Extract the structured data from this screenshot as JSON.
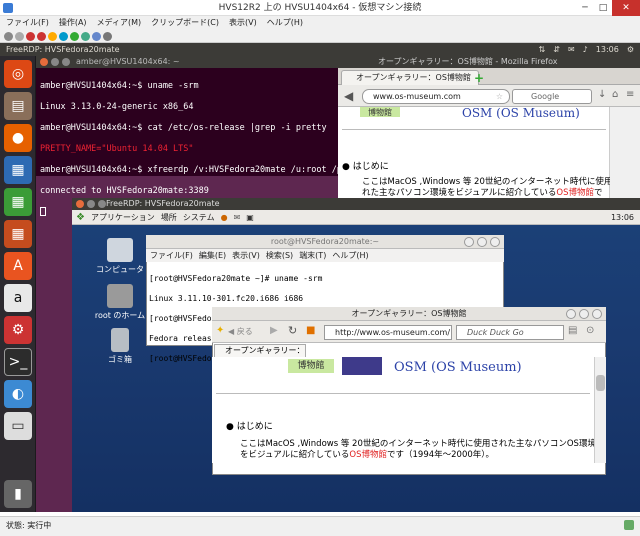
{
  "hyperv": {
    "title": "HVS12R2 上の HVSU1404x64 - 仮想マシン接続",
    "menu": [
      "ファイル(F)",
      "操作(A)",
      "メディア(M)",
      "クリップボード(C)",
      "表示(V)",
      "ヘルプ(H)"
    ],
    "status": "状態: 実行中"
  },
  "ubuntu": {
    "panel_title": "FreeRDP: HVSFedora20mate",
    "clock": "13:06",
    "terminal": {
      "title": "amber@HVSU1404x64: ~",
      "lines": [
        "amber@HVSU1404x64:~$ uname -srm",
        "Linux 3.13.0-24-generic x86_64",
        "amber@HVSU1404x64:~$ cat /etc/os-release |grep -i pretty",
        "PRETTY_NAME=\"Ubuntu 14.04 LTS\"",
        "amber@HVSU1404x64:~$ xfreerdp /v:HVSFedora20mate /u:root /p:",
        "connected to HVSFedora20mate:3389"
      ]
    },
    "firefox": {
      "title": "オープンギャラリー：OS博物館 - Mozilla Firefox",
      "tab": "オープンギャラリー：OS博物館",
      "url": "www.os-museum.com",
      "search": "Google",
      "site_title": "OSM (OS Museum)",
      "logo": "博物館",
      "bullet": "はじめに",
      "para_a": "ここはMacOS ,Windows 等 20世紀のインターネット時代に使用さ",
      "para_b": "れた主なパソコン環境をビジュアルに紹介している",
      "link": "OS博物館",
      "para_c": "で"
    }
  },
  "freerdp": {
    "title": "FreeRDP: HVSFedora20mate",
    "panel_menu": [
      "アプリケーション",
      "場所",
      "システム"
    ],
    "clock": "13:06",
    "desktop_icons": [
      "コンピュータ",
      "root のホーム",
      "ゴミ箱"
    ],
    "terminal": {
      "title": "root@HVSFedora20mate:~",
      "menu": [
        "ファイル(F)",
        "編集(E)",
        "表示(V)",
        "検索(S)",
        "端末(T)",
        "ヘルプ(H)"
      ],
      "lines": [
        "[root@HVSFedora20mate ~]# uname -srm",
        "Linux 3.11.10-301.fc20.i686 i686",
        "[root@HVSFedora20mate ~]# cat /etc/fedora-release",
        "Fedora release 20 (Heisenbug)",
        "[root@HVSFedora20mate ~]# "
      ]
    },
    "browser": {
      "title": "オープンギャラリー：OS博物館",
      "back": "戻る",
      "url": "http://www.os-museum.com/",
      "search": "Duck Duck Go",
      "tab": "オープンギャラリー：OS博物館",
      "logo": "博物館",
      "site_title": "OSM (OS Museum)",
      "bullet": "はじめに",
      "para_a": "ここはMacOS ,Windows 等 20世紀のインターネット時代に使用された主なパソコンOS環境",
      "para_b": "をビジュアルに紹介している",
      "link": "OS博物館",
      "para_c": "です（1994年～2000年）。"
    }
  },
  "colors": {
    "ubuntu_bg": "#5e2750",
    "terminal_bg": "#2c001e",
    "fedora_bg": "#1a3a70",
    "link": "#e02020",
    "title_blue": "#2c43a8"
  }
}
